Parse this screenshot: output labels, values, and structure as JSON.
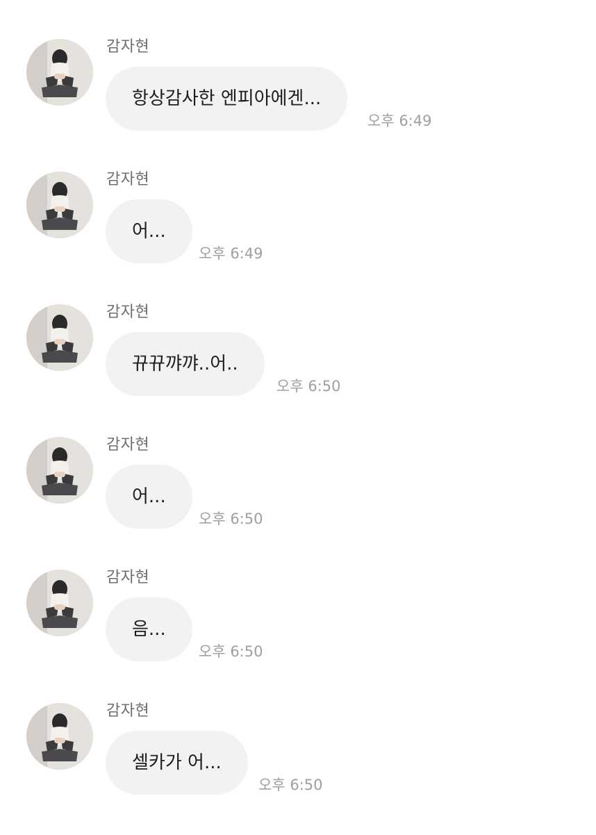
{
  "messages": [
    {
      "sender": "감자현",
      "avatar_icon": "profile-photo-icon",
      "text": "항상감사한 엔피아에겐...",
      "time": "오후 6:49"
    },
    {
      "sender": "감자현",
      "avatar_icon": "profile-photo-icon",
      "text": "어...",
      "time": "오후 6:49"
    },
    {
      "sender": "감자현",
      "avatar_icon": "profile-photo-icon",
      "text": "뀨뀨꺄꺄..어..",
      "time": "오후 6:50"
    },
    {
      "sender": "감자현",
      "avatar_icon": "profile-photo-icon",
      "text": "어...",
      "time": "오후 6:50"
    },
    {
      "sender": "감자현",
      "avatar_icon": "profile-photo-icon",
      "text": "음...",
      "time": "오후 6:50"
    },
    {
      "sender": "감자현",
      "avatar_icon": "profile-photo-icon",
      "text": "셀카가 어...",
      "time": "오후 6:50"
    }
  ],
  "colors": {
    "bubble": "#f2f2f5",
    "message_text": "#1d1d1f",
    "sender_text": "#6d6d72",
    "time_text": "#9e9ea3"
  }
}
